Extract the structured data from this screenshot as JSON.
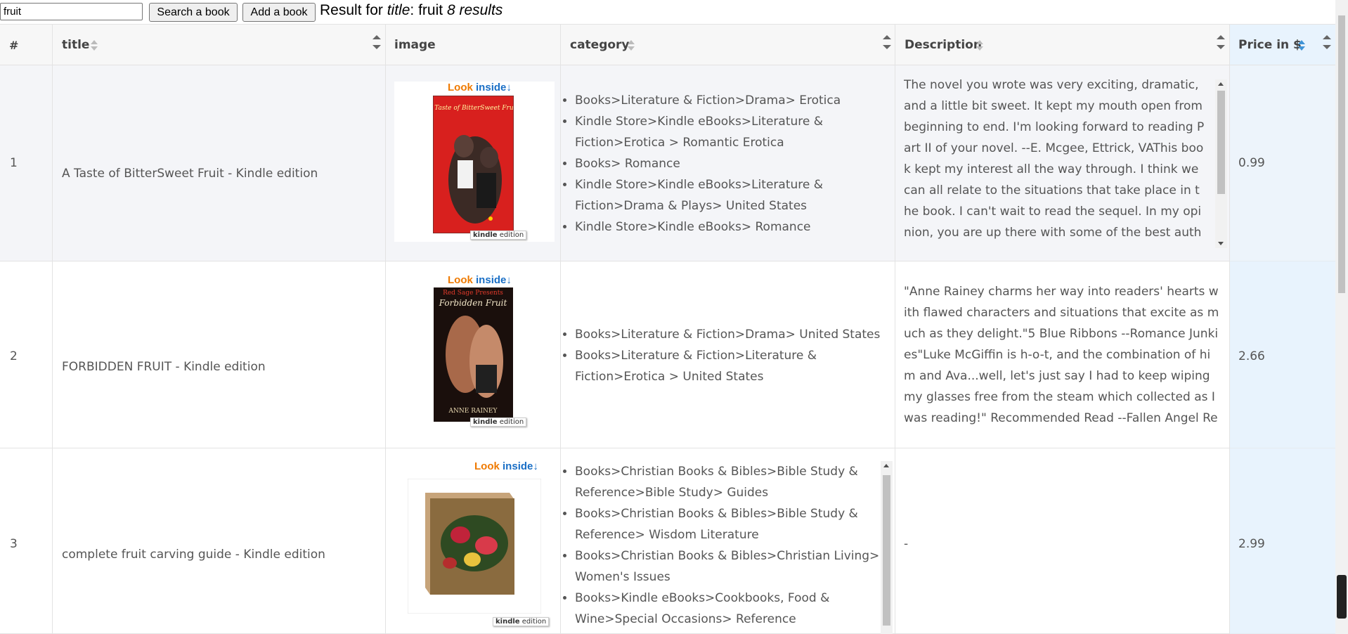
{
  "toolbar": {
    "search_value": "fruit",
    "search_button": "Search a book",
    "add_button": "Add a book",
    "result_prefix": "Result for",
    "result_field": "title",
    "result_sep": ": fruit",
    "result_count": "8 results"
  },
  "columns": {
    "num": "#",
    "title": "title",
    "image": "image",
    "category": "category",
    "description": "Description",
    "price": "Price in $"
  },
  "rows": [
    {
      "num": "1",
      "title": "A Taste of BitterSweet Fruit - Kindle edition",
      "cover": {
        "look_a": "Look",
        "look_b": "inside",
        "book_title": "A Taste of BitterSweet Fruit",
        "badge_a": "kindle",
        "badge_b": "edition"
      },
      "categories": [
        "Books>Literature & Fiction>Drama> Erotica",
        "Kindle Store>Kindle eBooks>Literature & Fiction>Erotica > Romantic Erotica",
        "Books> Romance",
        "Kindle Store>Kindle eBooks>Literature & Fiction>Drama & Plays> United States",
        "Kindle Store>Kindle eBooks> Romance"
      ],
      "description": "The novel you wrote was very exciting, dramatic, and a little bit sweet. It kept my mouth open from beginning to end. I'm looking forward to reading Part II of your novel. --E. Mcgee, Ettrick, VAThis book kept my interest all the way through. I think we can all relate to the situations that take place in the book. I can't wait to read the sequel. In my opinion, you are up there with some of the best authors, (Eric Jerome Dickey, Nikki Turner, Terry McMillan, etc.) - Brenda Winn, Ettrick",
      "price": "0.99"
    },
    {
      "num": "2",
      "title": "FORBIDDEN FRUIT - Kindle edition",
      "cover": {
        "look_a": "Look",
        "look_b": "inside",
        "book_title": "Forbidden Fruit",
        "publisher": "Red Sage Presents",
        "author": "ANNE RAINEY",
        "badge_a": "kindle",
        "badge_b": "edition"
      },
      "categories": [
        "Books>Literature & Fiction>Drama> United States",
        "Books>Literature & Fiction>Literature & Fiction>Erotica > United States"
      ],
      "description": "\"Anne Rainey charms her way into readers' hearts with flawed characters and situations that excite as much as they delight.\"5 Blue Ribbons  --Romance Junkies\"Luke McGiffin is h-o-t, and the combination of him and Ava...well, let's just say I had to keep wiping my glasses free from the steam which collected as I was reading!\" Recommended Read --Fallen Angel Reviews",
      "price": "2.66"
    },
    {
      "num": "3",
      "title": "complete fruit carving guide - Kindle edition",
      "cover": {
        "look_a": "Look",
        "look_b": "inside",
        "badge_a": "kindle",
        "badge_b": "edition"
      },
      "categories": [
        "Books>Christian Books & Bibles>Bible Study & Reference>Bible Study> Guides",
        "Books>Christian Books & Bibles>Bible Study & Reference> Wisdom Literature",
        "Books>Christian Books & Bibles>Christian Living> Women's Issues",
        "Books>Kindle eBooks>Cookbooks, Food & Wine>Special Occasions> Reference"
      ],
      "description": "-",
      "price": "2.99"
    }
  ]
}
